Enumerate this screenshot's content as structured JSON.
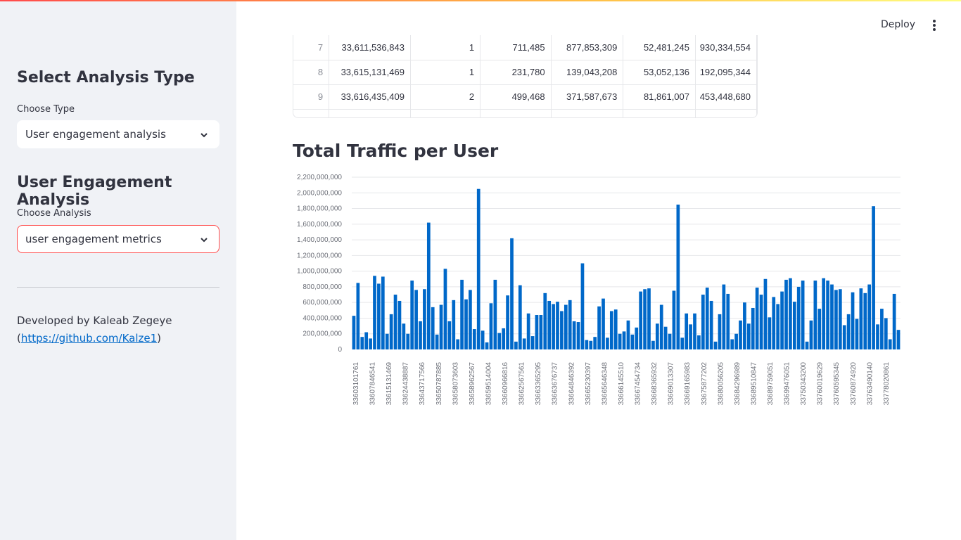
{
  "sidebar": {
    "heading1": "Select Analysis Type",
    "type_label": "Choose Type",
    "type_value": "User engagement analysis",
    "heading2": "User Engagement Analysis",
    "analysis_label": "Choose Analysis",
    "analysis_value": "user engagement metrics",
    "credit_text": "Developed by Kaleab Zegeye",
    "credit_paren_open": "(",
    "credit_link": "https://github.com/Kalze1",
    "credit_paren_close": ")"
  },
  "header": {
    "deploy_label": "Deploy",
    "menu_icon": "kebab-menu-icon"
  },
  "table": {
    "rows": [
      [
        "7",
        "33,611,536,843",
        "1",
        "711,485",
        "877,853,309",
        "52,481,245",
        "930,334,554"
      ],
      [
        "8",
        "33,615,131,469",
        "1",
        "231,780",
        "139,043,208",
        "53,052,136",
        "192,095,344"
      ],
      [
        "9",
        "33,616,435,409",
        "2",
        "499,468",
        "371,587,673",
        "81,861,007",
        "453,448,680"
      ]
    ]
  },
  "chart_title": "Total Traffic per User",
  "colors": {
    "bar": "#0068c9",
    "accent": "#ff4b4b"
  },
  "chart_data": {
    "type": "bar",
    "title": "Total Traffic per User",
    "ylim": [
      0,
      2200000000
    ],
    "y_ticks": [
      "0",
      "200,000,000",
      "400,000,000",
      "600,000,000",
      "800,000,000",
      "1,000,000,000",
      "1,200,000,000",
      "1,400,000,000",
      "1,600,000,000",
      "1,800,000,000",
      "2,000,000,000",
      "2,200,000,000"
    ],
    "x_tick_labels": [
      "33603101761",
      "33607846541",
      "33615131469",
      "33624438887",
      "33643717566",
      "33650787885",
      "33658073603",
      "33658962567",
      "33659514004",
      "33660966816",
      "33662567561",
      "33663365295",
      "33663676737",
      "33664846392",
      "33665230397",
      "33665646348",
      "33666145510",
      "33667454734",
      "33668365932",
      "33669013307",
      "33669165983",
      "33675877202",
      "33680056205",
      "33684296989",
      "33689510847",
      "33689759051",
      "33699476051",
      "33750343200",
      "33760019629",
      "33760595345",
      "33760874920",
      "33763490140",
      "33778020861"
    ],
    "values": [
      430000000,
      850000000,
      160000000,
      220000000,
      140000000,
      940000000,
      840000000,
      930000000,
      200000000,
      450000000,
      700000000,
      620000000,
      330000000,
      200000000,
      880000000,
      760000000,
      360000000,
      770000000,
      1620000000,
      540000000,
      190000000,
      570000000,
      1030000000,
      360000000,
      630000000,
      130000000,
      890000000,
      640000000,
      760000000,
      260000000,
      2050000000,
      240000000,
      90000000,
      590000000,
      890000000,
      210000000,
      270000000,
      690000000,
      1420000000,
      100000000,
      820000000,
      140000000,
      460000000,
      170000000,
      440000000,
      440000000,
      720000000,
      620000000,
      580000000,
      610000000,
      490000000,
      570000000,
      630000000,
      360000000,
      350000000,
      1100000000,
      120000000,
      110000000,
      160000000,
      550000000,
      650000000,
      150000000,
      490000000,
      510000000,
      200000000,
      230000000,
      370000000,
      190000000,
      280000000,
      740000000,
      770000000,
      780000000,
      110000000,
      330000000,
      570000000,
      290000000,
      200000000,
      750000000,
      1850000000,
      150000000,
      460000000,
      320000000,
      460000000,
      180000000,
      700000000,
      790000000,
      620000000,
      100000000,
      450000000,
      830000000,
      710000000,
      130000000,
      200000000,
      370000000,
      600000000,
      330000000,
      530000000,
      790000000,
      700000000,
      900000000,
      410000000,
      670000000,
      580000000,
      740000000,
      890000000,
      910000000,
      610000000,
      800000000,
      880000000,
      100000000,
      370000000,
      880000000,
      520000000,
      910000000,
      880000000,
      830000000,
      760000000,
      770000000,
      310000000,
      450000000,
      730000000,
      390000000,
      780000000,
      720000000,
      830000000,
      1830000000,
      320000000,
      520000000,
      400000000,
      130000000,
      710000000,
      250000000
    ]
  }
}
